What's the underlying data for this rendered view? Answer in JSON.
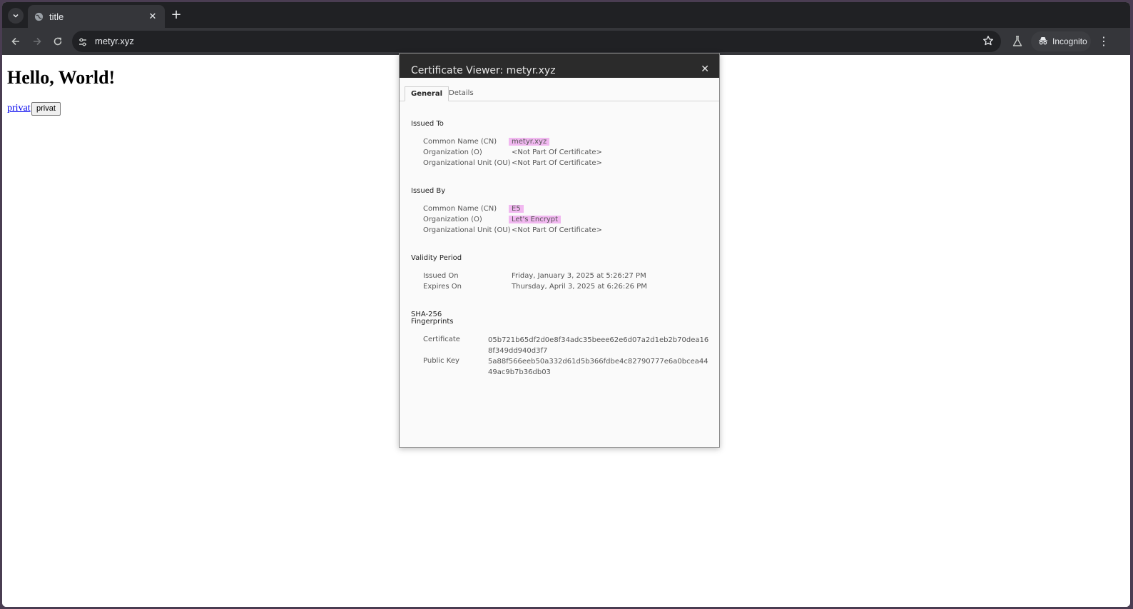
{
  "browser": {
    "tab_title": "title",
    "url": "metyr.xyz",
    "incognito_label": "Incognito",
    "icons": {
      "tab_search": "chevron-down-icon",
      "favicon": "globe-icon",
      "close": "close-icon",
      "new_tab": "plus-icon",
      "back": "arrow-left-icon",
      "forward": "arrow-right-icon",
      "reload": "reload-icon",
      "site_info": "tune-icon",
      "bookmark": "star-icon",
      "labs": "flask-icon",
      "incognito": "incognito-icon",
      "menu": "kebab-menu-icon"
    }
  },
  "page": {
    "heading": "Hello, World!",
    "link_text": "privat",
    "button_label": "privat"
  },
  "dialog": {
    "title": "Certificate Viewer: metyr.xyz",
    "close_glyph": "✕",
    "tabs": [
      {
        "label": "General",
        "active": true
      },
      {
        "label": "Details",
        "active": false
      }
    ],
    "issued_to": {
      "heading": "Issued To",
      "rows": [
        {
          "label": "Common Name (CN)",
          "value": "metyr.xyz",
          "highlight": true
        },
        {
          "label": "Organization (O)",
          "value": "<Not Part Of Certificate>",
          "highlight": false
        },
        {
          "label": "Organizational Unit (OU)",
          "value": "<Not Part Of Certificate>",
          "highlight": false
        }
      ]
    },
    "issued_by": {
      "heading": "Issued By",
      "rows": [
        {
          "label": "Common Name (CN)",
          "value": "E5",
          "highlight": true
        },
        {
          "label": "Organization (O)",
          "value": "Let's Encrypt",
          "highlight": true
        },
        {
          "label": "Organizational Unit (OU)",
          "value": "<Not Part Of Certificate>",
          "highlight": false
        }
      ]
    },
    "validity": {
      "heading": "Validity Period",
      "rows": [
        {
          "label": "Issued On",
          "value": "Friday, January 3, 2025 at 5:26:27 PM"
        },
        {
          "label": "Expires On",
          "value": "Thursday, April 3, 2025 at 6:26:26 PM"
        }
      ]
    },
    "fingerprints": {
      "heading_line1": "SHA-256",
      "heading_line2": "Fingerprints",
      "rows": [
        {
          "label": "Certificate",
          "value": "05b721b65df2d0e8f34adc35beee62e6d07a2d1eb2b70dea168f349dd940d3f7"
        },
        {
          "label": "Public Key",
          "value": "5a88f566eeb50a332d61d5b366fdbe4c82790777e6a0bcea4449ac9b7b36db03"
        }
      ]
    }
  }
}
